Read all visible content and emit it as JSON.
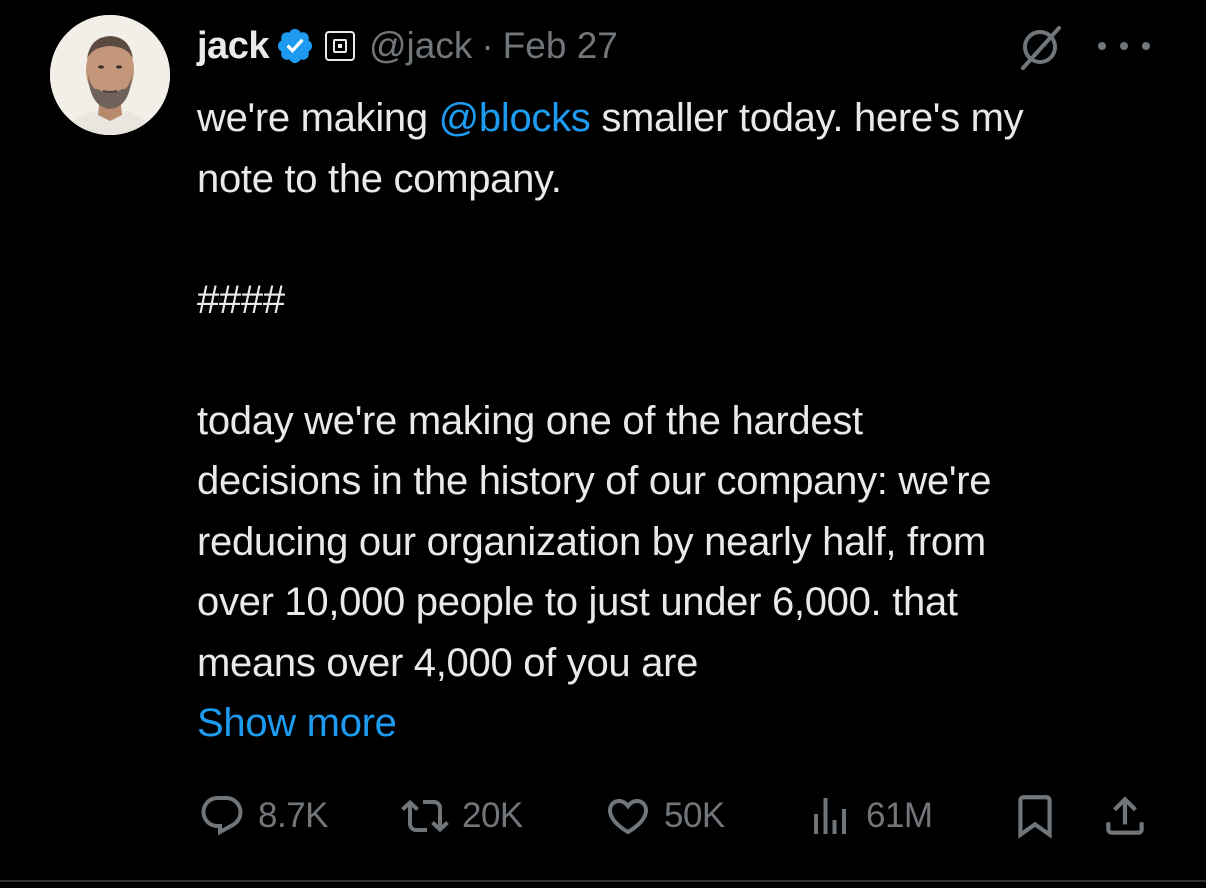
{
  "author": {
    "name": "jack",
    "handle": "@jack",
    "separator": "·",
    "date": "Feb 27"
  },
  "tweet": {
    "line1_before": "we're making ",
    "line1_mention": "@blocks",
    "line1_after": " smaller today. here's my",
    "line2": "note to the company.",
    "line4": "####",
    "line6": "today we're making one of the hardest",
    "line7": "decisions in the history of our company: we're",
    "line8": "reducing our organization by nearly half, from",
    "line9": "over 10,000 people to just under 6,000. that",
    "line10": "means over 4,000 of you are",
    "show_more": "Show more"
  },
  "actions": {
    "replies": "8.7K",
    "reposts": "20K",
    "likes": "50K",
    "views": "61M"
  },
  "icons": {
    "verified": "verified-badge-icon",
    "affiliate": "square-affiliate-icon",
    "grok": "grok-icon",
    "more": "more-icon",
    "reply": "reply-icon",
    "repost": "repost-icon",
    "like": "heart-icon",
    "views": "views-icon",
    "bookmark": "bookmark-icon",
    "share": "share-icon"
  },
  "colors": {
    "background": "#000000",
    "text": "#e7e9ea",
    "muted": "#71767b",
    "accent": "#1d9bf0"
  }
}
